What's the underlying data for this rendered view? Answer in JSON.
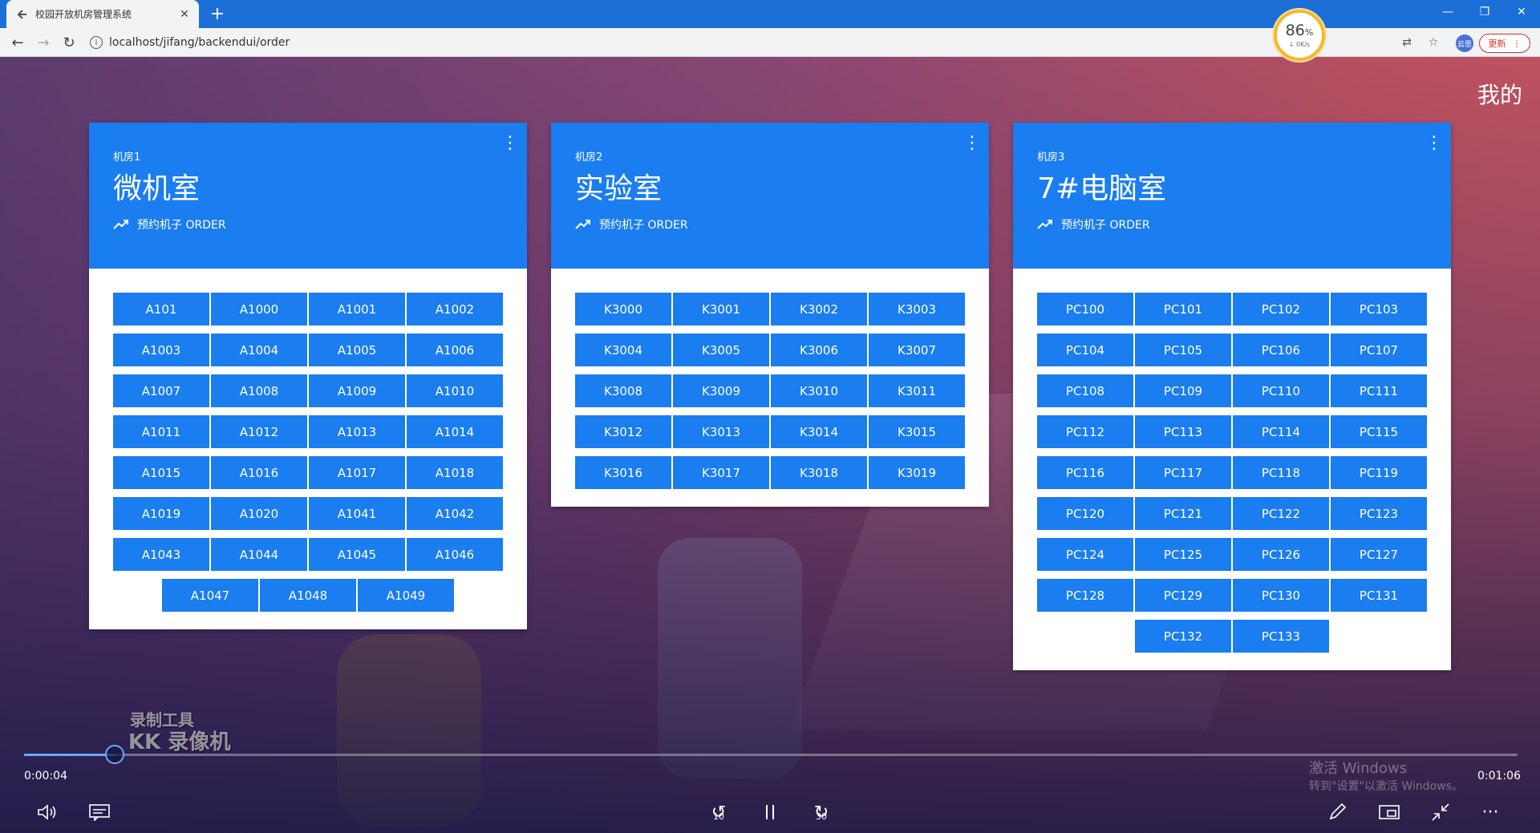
{
  "browser": {
    "tab_title": "校园开放机房管理系统",
    "url": "localhost/jifang/backendui/order",
    "update_label": "更新",
    "avatar_text": "云思",
    "speed_percent": "86",
    "speed_unit": "%",
    "speed_rate": "↓ 0K/s"
  },
  "page": {
    "user_menu": "我的",
    "rooms": [
      {
        "number": "机房1",
        "name": "微机室",
        "subtitle": "预约机子 ORDER",
        "machines": [
          "A101",
          "A1000",
          "A1001",
          "A1002",
          "A1003",
          "A1004",
          "A1005",
          "A1006",
          "A1007",
          "A1008",
          "A1009",
          "A1010",
          "A1011",
          "A1012",
          "A1013",
          "A1014",
          "A1015",
          "A1016",
          "A1017",
          "A1018",
          "A1019",
          "A1020",
          "A1041",
          "A1042",
          "A1043",
          "A1044",
          "A1045",
          "A1046",
          "A1047",
          "A1048",
          "A1049"
        ]
      },
      {
        "number": "机房2",
        "name": "实验室",
        "subtitle": "预约机子 ORDER",
        "machines": [
          "K3000",
          "K3001",
          "K3002",
          "K3003",
          "K3004",
          "K3005",
          "K3006",
          "K3007",
          "K3008",
          "K3009",
          "K3010",
          "K3011",
          "K3012",
          "K3013",
          "K3014",
          "K3015",
          "K3016",
          "K3017",
          "K3018",
          "K3019"
        ]
      },
      {
        "number": "机房3",
        "name": "7#电脑室",
        "subtitle": "预约机子 ORDER",
        "machines": [
          "PC100",
          "PC101",
          "PC102",
          "PC103",
          "PC104",
          "PC105",
          "PC106",
          "PC107",
          "PC108",
          "PC109",
          "PC110",
          "PC111",
          "PC112",
          "PC113",
          "PC114",
          "PC115",
          "PC116",
          "PC117",
          "PC118",
          "PC119",
          "PC120",
          "PC121",
          "PC122",
          "PC123",
          "PC124",
          "PC125",
          "PC126",
          "PC127",
          "PC128",
          "PC129",
          "PC130",
          "PC131",
          "PC132",
          "PC133"
        ]
      }
    ]
  },
  "player": {
    "current_time": "0:00:04",
    "total_time": "0:01:06",
    "progress_fraction": 0.0606,
    "skip_back_label": "10",
    "skip_forward_label": "30",
    "watermark_line1": "录制工具",
    "watermark_line2": "KK 录像机",
    "activation_line1": "激活 Windows",
    "activation_line2": "转到\"设置\"以激活 Windows。"
  },
  "colors": {
    "accent": "#1a7df0",
    "browser_blue": "#1d6fd8"
  }
}
